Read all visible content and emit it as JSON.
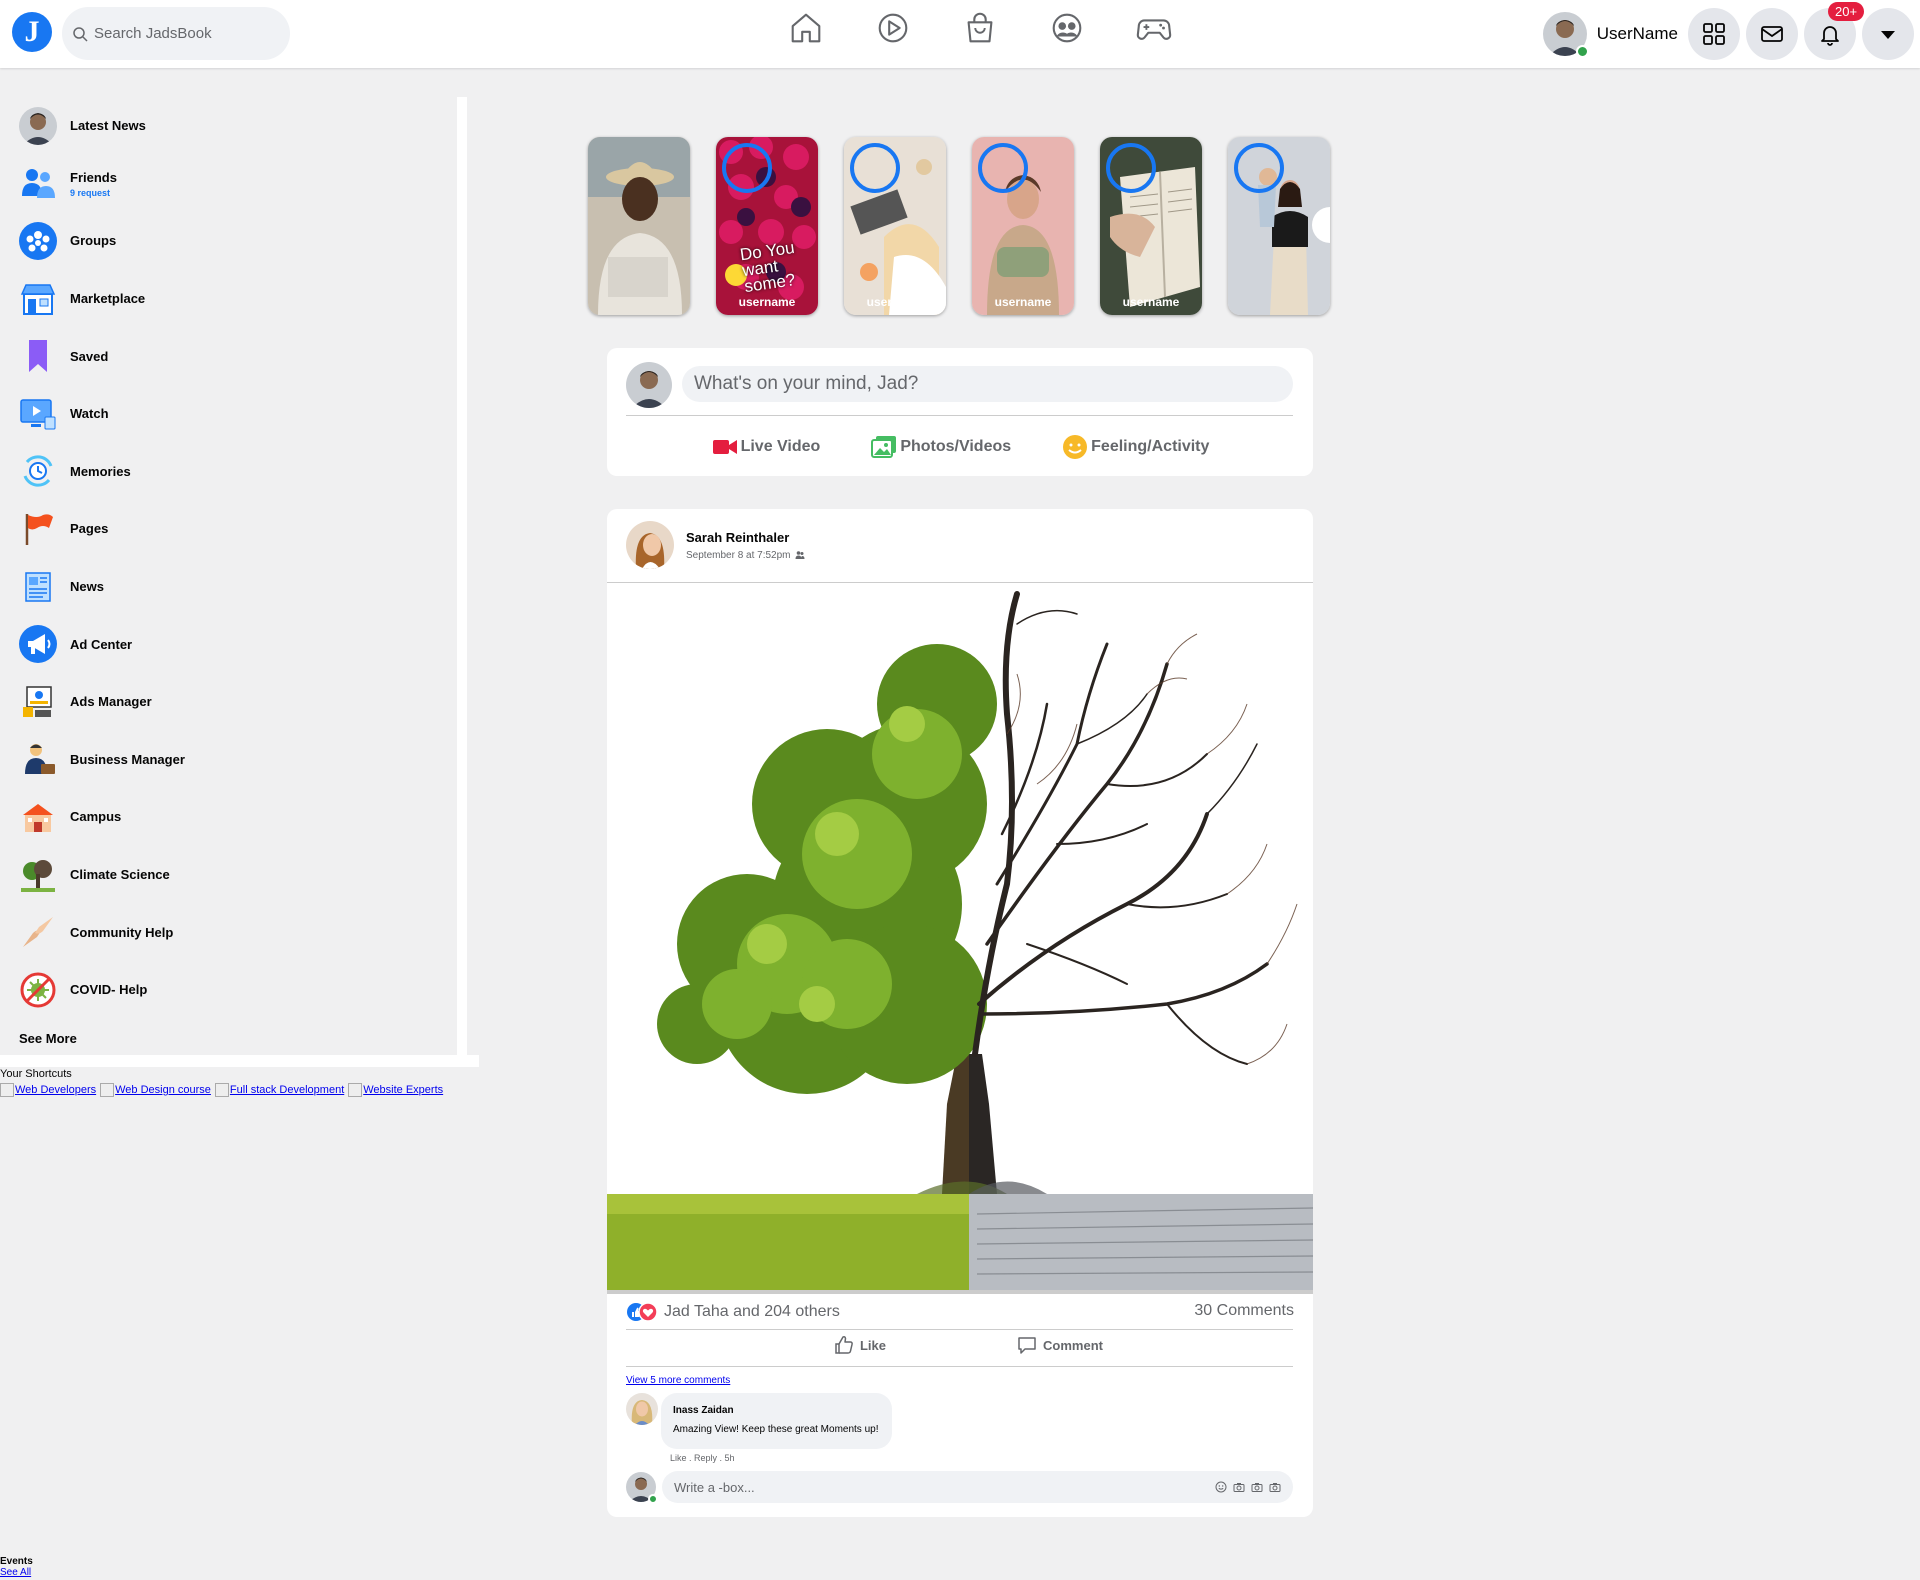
{
  "header": {
    "logo_text": "J",
    "search_placeholder": "Search JadsBook",
    "nav_icons": [
      "home-icon",
      "watch-icon",
      "marketplace-icon",
      "groups-icon",
      "gaming-icon"
    ],
    "username": "UserName",
    "notification_badge": "20+",
    "accent_color": "#1877f2"
  },
  "sidebar": {
    "items": [
      {
        "label": "Latest News",
        "icon": "profile-avatar"
      },
      {
        "label": "Friends",
        "sub": "9 request",
        "icon": "friends-icon"
      },
      {
        "label": "Groups",
        "icon": "groups-icon"
      },
      {
        "label": "Marketplace",
        "icon": "marketplace-icon"
      },
      {
        "label": "Saved",
        "icon": "bookmark-icon"
      },
      {
        "label": "Watch",
        "icon": "watch-icon"
      },
      {
        "label": "Memories",
        "icon": "memories-icon"
      },
      {
        "label": "Pages",
        "icon": "flag-icon"
      },
      {
        "label": "News",
        "icon": "news-icon"
      },
      {
        "label": "Ad Center",
        "icon": "megaphone-icon"
      },
      {
        "label": "Ads Manager",
        "icon": "ads-manager-icon"
      },
      {
        "label": "Business Manager",
        "icon": "business-icon"
      },
      {
        "label": "Campus",
        "icon": "campus-icon"
      },
      {
        "label": "Climate Science",
        "icon": "tree-icon"
      },
      {
        "label": "Community Help",
        "icon": "helping-hands-icon"
      },
      {
        "label": "COVID- Help",
        "icon": "virus-icon"
      }
    ],
    "see_more": "See More"
  },
  "shortcuts": {
    "title": "Your Shortcuts",
    "links": [
      "Web Developers",
      "Web Design course",
      "Full stack Development",
      "Website Experts"
    ]
  },
  "events": {
    "title": "Events",
    "see_all": "See All"
  },
  "stories": [
    {
      "name": ""
    },
    {
      "name": "username",
      "text": "Do You want some?"
    },
    {
      "name": "username"
    },
    {
      "name": "username"
    },
    {
      "name": "username"
    },
    {
      "name": ""
    }
  ],
  "composer": {
    "placeholder": "What's on your mind, Jad?",
    "actions": [
      {
        "label": "Live Video",
        "icon": "live-video-icon"
      },
      {
        "label": "Photos/Videos",
        "icon": "photos-icon"
      },
      {
        "label": "Feeling/Activity",
        "icon": "smiley-icon"
      }
    ]
  },
  "post": {
    "author": "Sarah Reinthaler",
    "date": "September 8 at 7:52pm",
    "reactions_text": "Jad Taha and 204 others",
    "comments_count": "30 Comments",
    "like_label": "Like",
    "comment_label": "Comment",
    "view_more": "View 5 more comments",
    "comment": {
      "author": "Inass Zaidan",
      "text": "Amazing View! Keep these great Moments up!",
      "meta": "Like . Reply . 5h"
    },
    "reply_placeholder": "Write a -box..."
  }
}
